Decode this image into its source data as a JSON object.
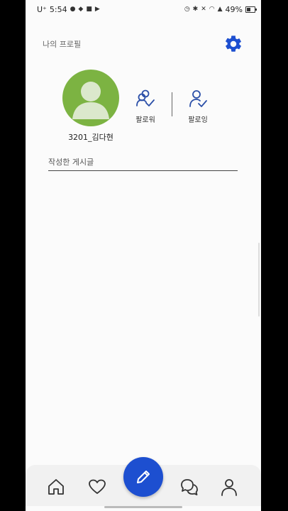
{
  "status_bar": {
    "carrier": "U⁺",
    "time": "5:54",
    "battery": "49%",
    "battery_level": 0.49
  },
  "header": {
    "title": "나의 프로필",
    "settings_icon": "gear-icon"
  },
  "profile": {
    "username": "3201_김다현",
    "avatar_color": "#7cb342"
  },
  "follow": {
    "followers_label": "팔로워",
    "following_label": "팔로잉"
  },
  "posts": {
    "tab_label": "작성한 게시글"
  },
  "bottom_nav": {
    "items": [
      "home-icon",
      "heart-icon",
      "pencil-icon",
      "chat-icon",
      "person-icon"
    ],
    "accent": "#1d4fd0"
  }
}
